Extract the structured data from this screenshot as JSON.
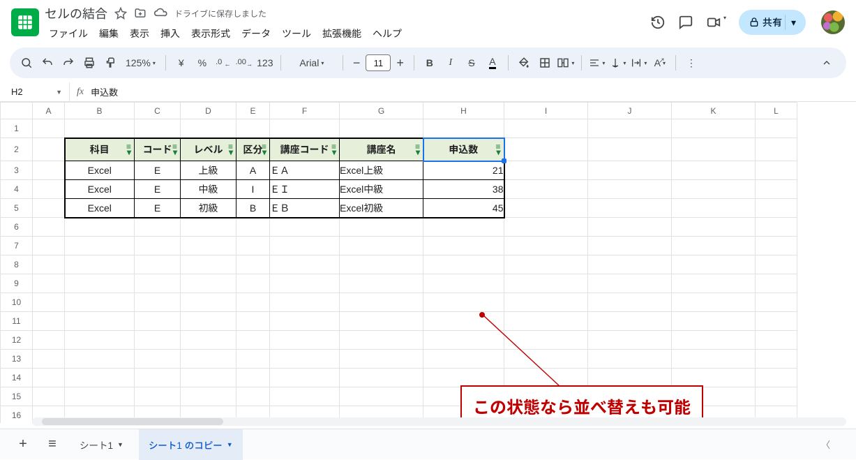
{
  "title": {
    "doc_name": "セルの結合",
    "save_status": "ドライブに保存しました"
  },
  "menu": {
    "file": "ファイル",
    "edit": "編集",
    "view": "表示",
    "insert": "挿入",
    "format": "表示形式",
    "data": "データ",
    "tools": "ツール",
    "extensions": "拡張機能",
    "help": "ヘルプ"
  },
  "toolbar": {
    "zoom": "125%",
    "font": "Arial",
    "font_size": "11",
    "currency": "¥",
    "percent": "%",
    "dec_dec": ".0",
    "inc_dec": ".00",
    "num_fmt": "123",
    "share_label": "共有"
  },
  "namebox": {
    "cell": "H2",
    "formula": "申込数"
  },
  "columns": [
    "A",
    "B",
    "C",
    "D",
    "E",
    "F",
    "G",
    "H",
    "I",
    "J",
    "K",
    "L"
  ],
  "rows": [
    "1",
    "2",
    "3",
    "4",
    "5",
    "6",
    "7",
    "8",
    "9",
    "10",
    "11",
    "12",
    "13",
    "14",
    "15",
    "16"
  ],
  "active_cell": "H2",
  "headers": {
    "B": "科目",
    "C": "コード",
    "D": "レベル",
    "E": "区分",
    "F": "講座コード",
    "G": "講座名",
    "H": "申込数"
  },
  "table": [
    {
      "B": "Excel",
      "C": "E",
      "D": "上級",
      "E": "A",
      "F": "ＥＡ",
      "G": "Excel上級",
      "H": "21"
    },
    {
      "B": "Excel",
      "C": "E",
      "D": "中級",
      "E": "I",
      "F": "ＥＩ",
      "G": "Excel中級",
      "H": "38"
    },
    {
      "B": "Excel",
      "C": "E",
      "D": "初級",
      "E": "B",
      "F": "ＥＢ",
      "G": "Excel初級",
      "H": "45"
    }
  ],
  "annotation": {
    "text": "この状態なら並べ替えも可能"
  },
  "sheets": {
    "add": "+",
    "list": "≡",
    "tab1": "シート1",
    "tab2": "シート1 のコピー"
  }
}
